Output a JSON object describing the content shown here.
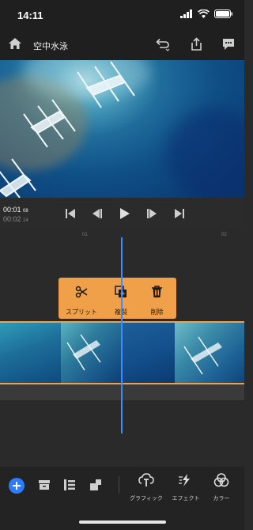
{
  "status": {
    "time": "14:11"
  },
  "app": {
    "title": "空中水泳"
  },
  "timecode": {
    "current": "00:01",
    "current_frames": "08",
    "total": "00:02",
    "total_frames": "14"
  },
  "ruler": {
    "mark1": "01",
    "mark2": "02"
  },
  "popup": {
    "split": "スプリット",
    "duplicate": "複製",
    "delete": "削除"
  },
  "bottom_tools": {
    "graphics": "グラフィック",
    "effects": "エフェクト",
    "color": "カラー"
  },
  "colors": {
    "accent": "#f0a048",
    "playhead": "#3b8cff",
    "add_button": "#2d7bff"
  }
}
